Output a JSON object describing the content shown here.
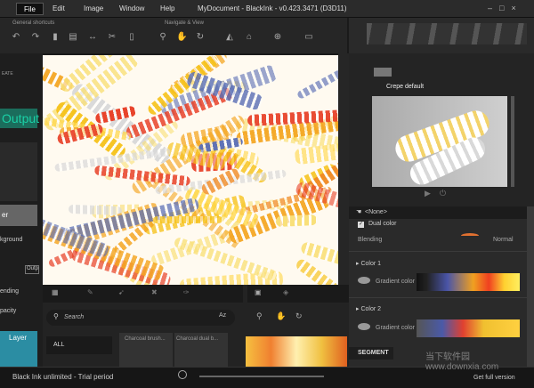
{
  "menus": [
    "File",
    "Edit",
    "Image",
    "Window",
    "Help"
  ],
  "window_title": "MyDocument - BlackInk - v0.423.3471 (D3D11)",
  "toolbar": {
    "general_label": "General shortcuts",
    "navigate_label": "Navigate & View"
  },
  "left": {
    "create_label": "EATE",
    "output_label": "Output",
    "layer_label": "er",
    "background_label": "kground",
    "blend_label": "ending",
    "opacity_label": "pacity",
    "layer_tab": "Layer",
    "out_button": "Outp"
  },
  "brush_panel": {
    "preset_name": "Crepe default",
    "none_label": "<None>"
  },
  "props": {
    "dual_color": "Dual color",
    "blending": "Blending",
    "blending_value": "Normal",
    "color1": "Color 1",
    "color2": "Color 2",
    "gradient1": "Gradient color",
    "gradient2": "Gradient color",
    "segment": "SEGMENT"
  },
  "browser": {
    "search_placeholder": "Search",
    "sort": "Az",
    "all": "ALL",
    "item1": "Charcoal brush...",
    "item2": "Charcoal dual b..."
  },
  "status": {
    "left": "Black Ink unlimited - Trial period",
    "right": "Get full version"
  },
  "watermark": "当下软件园  www.downxia.com"
}
